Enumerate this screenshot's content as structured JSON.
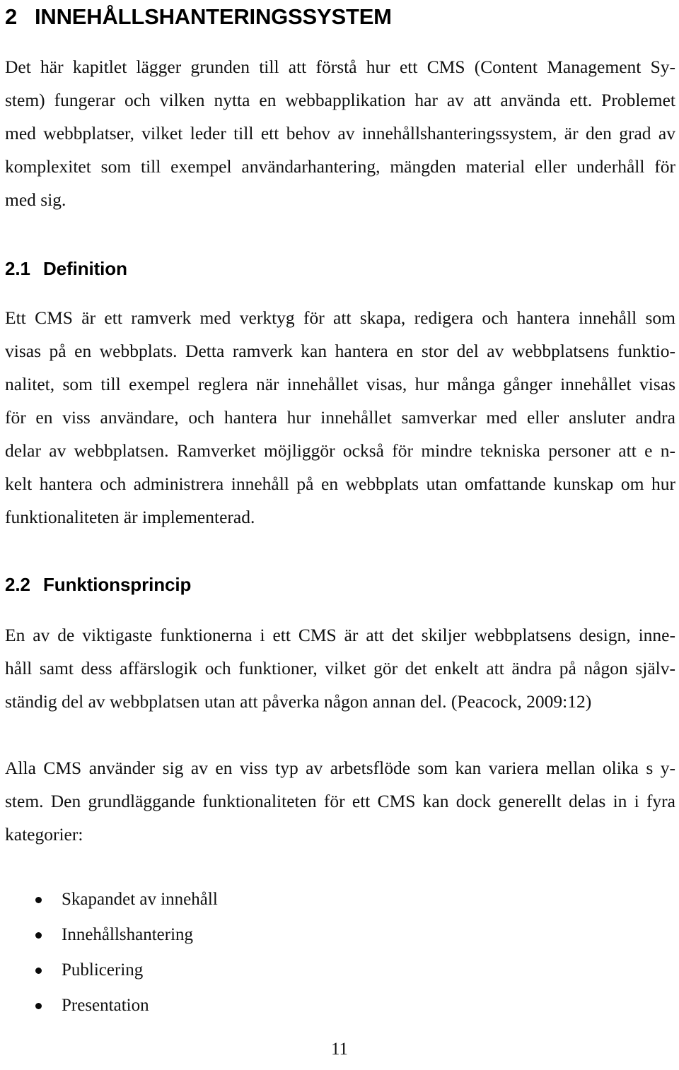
{
  "page": {
    "number": "11",
    "language": "sv"
  },
  "heading1": {
    "number": "2",
    "title": "INNEHÅLLSHANTERINGSSYSTEM"
  },
  "intro_paragraph": {
    "full_text": "Det här kapitlet lägger grunden till att förstå hur ett CMS (Content Management System) fungerar och vilken nytta en webbapplikation har av att använda ett. Problemet med webbplatser, vilket leder till ett behov av innehållshanteringssystem, är den grad av komplexitet som till exempel användarhantering, mängden material eller underhåll för med sig.",
    "lines": [
      "Det här kapitlet lägger grunden till att förstå hur ett CMS (Content Management Sy-",
      "stem) fungerar och vilken nytta en webbapplikation har av att använda ett. Problemet",
      "med webbplatser, vilket leder till ett behov av innehållshanteringssystem, är den grad av",
      "komplexitet som till exempel användarhantering, mängden material eller underhåll för",
      "med sig."
    ]
  },
  "section_2_1": {
    "number": "2.1",
    "title": "Definition",
    "paragraph": {
      "full_text": "Ett CMS är ett ramverk med verktyg för att skapa, redigera och hantera innehåll som visas på en webbplats. Detta ramverk kan hantera en stor del av webbplatsens funktionalitet, som till exempel reglera när innehållet visas, hur många gånger innehållet visas för en viss användare, och hantera hur innehållet samverkar med eller ansluter andra delar av webbplatsen. Ramverket möjliggör också för mindre tekniska personer att enkelt hantera och administrera innehåll på en webbplats utan omfattande kunskap om hur funktionaliteten är implementerad.",
      "lines": [
        "Ett CMS är ett ramverk med verktyg för att skapa, redigera och hantera innehåll som",
        "visas på en webbplats. Detta ramverk kan hantera en stor del av webbplatsens funktio-",
        "nalitet, som till exempel reglera när innehållet visas, hur många gånger innehållet visas",
        "för en viss användare, och hantera hur innehållet samverkar med eller ansluter andra",
        "delar av webbplatsen. Ramverket möjliggör också för mindre tekniska personer att e n-",
        "kelt hantera och administrera innehåll på en webbplats utan omfattande kunskap om hur",
        "funktionaliteten är implementerad."
      ]
    }
  },
  "section_2_2": {
    "number": "2.2",
    "title": "Funktionsprincip",
    "paragraph_1": {
      "full_text": "En av de viktigaste funktionerna i ett CMS  är att det skiljer webbplatsens design, innehåll samt dess affärslogik och funktioner, vilket gör det enkelt att ändra på någon självständig del av webbplatsen utan att påverka någon annan del. (Peacock, 2009:12)",
      "lines": [
        "En av de viktigaste funktionerna i ett CMS  är att det skiljer webbplatsens design, inne-",
        "håll samt dess affärslogik och funktioner, vilket gör det enkelt att ändra på någon själv-",
        "ständig del av webbplatsen utan att påverka någon annan del. (Peacock, 2009:12)"
      ]
    },
    "paragraph_2": {
      "full_text": "Alla CMS använder sig av en viss typ av arbetsflöde som kan variera mellan olika system. Den grundläggande funktionaliteten för ett CMS kan dock generellt delas in i fyra kategorier:",
      "lines": [
        "Alla CMS använder sig av en viss typ av arbetsflöde som kan variera mellan olika s y-",
        "stem. Den grundläggande funktionaliteten för ett CMS kan dock generellt delas in i fyra",
        "kategorier:"
      ]
    },
    "bullets": [
      "Skapandet av innehåll",
      "Innehållshantering",
      "Publicering",
      "Presentation"
    ]
  }
}
